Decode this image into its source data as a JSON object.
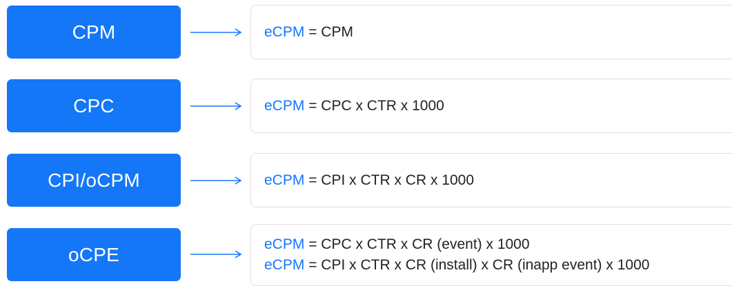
{
  "colors": {
    "accent": "#1477f8",
    "text": "#222222",
    "box_border": "#e0e0e0"
  },
  "rows": [
    {
      "label": "CPM",
      "formulas": [
        {
          "term": "eCPM",
          "expr": " = CPM"
        }
      ]
    },
    {
      "label": "CPC",
      "formulas": [
        {
          "term": "eCPM",
          "expr": " = CPC x CTR x 1000"
        }
      ]
    },
    {
      "label": "CPI/oCPM",
      "formulas": [
        {
          "term": "eCPM",
          "expr": " = CPI x CTR x CR x 1000"
        }
      ]
    },
    {
      "label": "oCPE",
      "formulas": [
        {
          "term": "eCPM",
          "expr": " = CPC x CTR x CR (event) x 1000"
        },
        {
          "term": "eCPM",
          "expr": " = CPI x CTR x CR (install) x CR (inapp event) x 1000"
        }
      ]
    }
  ]
}
